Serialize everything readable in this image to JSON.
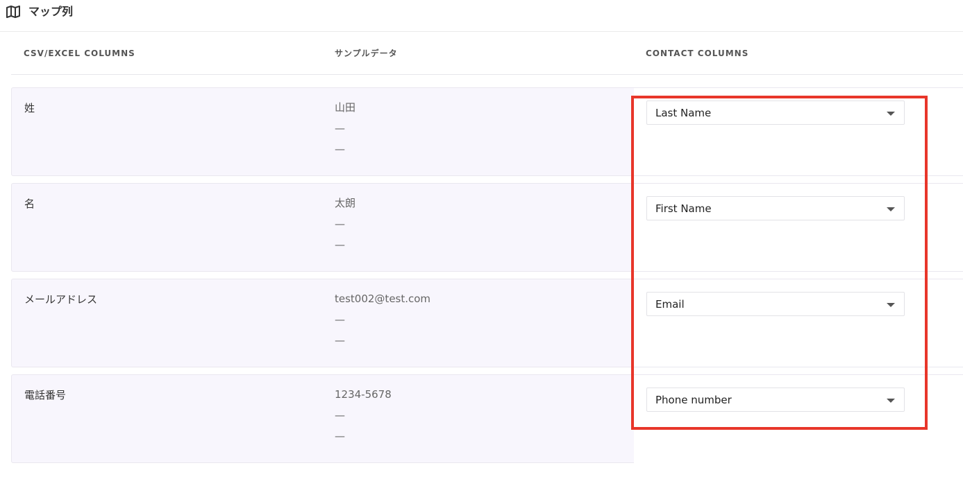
{
  "header": {
    "title": "マップ列",
    "icon": "map-icon"
  },
  "columns": {
    "source": "CSV/EXCEL COLUMNS",
    "sample": "サンプルデータ",
    "contact": "CONTACT COLUMNS"
  },
  "rows": [
    {
      "source": "姓",
      "samples": [
        "山田",
        "—",
        "—"
      ],
      "mapped": "Last Name"
    },
    {
      "source": "名",
      "samples": [
        "太朗",
        "—",
        "—"
      ],
      "mapped": "First Name"
    },
    {
      "source": "メールアドレス",
      "samples": [
        "test002@test.com",
        "—",
        "—"
      ],
      "mapped": "Email"
    },
    {
      "source": "電話番号",
      "samples": [
        "1234-5678",
        "—",
        "—"
      ],
      "mapped": "Phone number"
    }
  ],
  "highlight": {
    "color": "#e8362a"
  }
}
